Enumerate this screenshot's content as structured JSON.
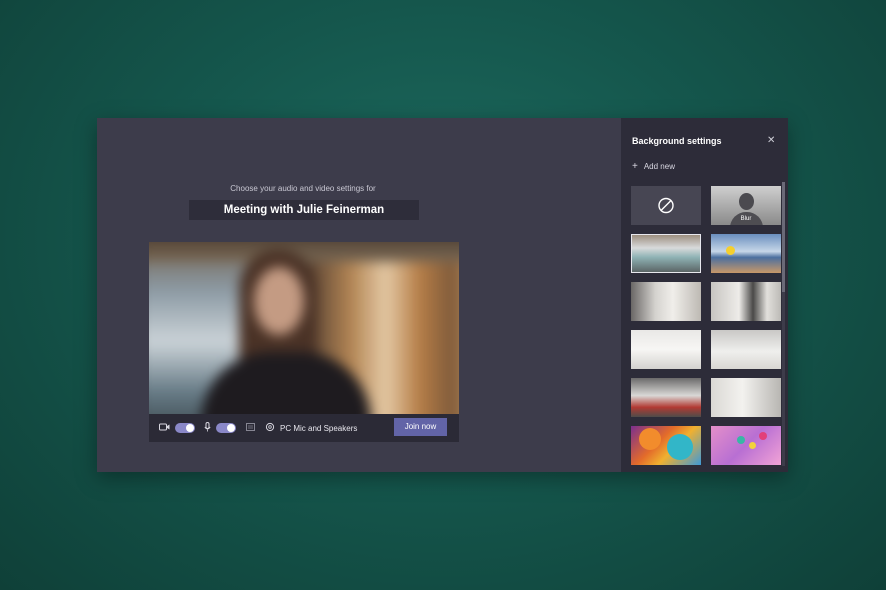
{
  "preview": {
    "subtitle": "Choose your audio and video settings for",
    "meeting_title": "Meeting with Julie Feinerman"
  },
  "controls": {
    "camera_icon": "camera-icon",
    "camera_on": true,
    "mic_icon": "microphone-icon",
    "mic_on": true,
    "audio_device": "PC Mic and Speakers",
    "join_label": "Join now"
  },
  "background_settings": {
    "title": "Background settings",
    "close_icon": "close-icon",
    "add_new_label": "Add new",
    "options": [
      {
        "kind": "none",
        "label": ""
      },
      {
        "kind": "blur",
        "label": "Blur"
      },
      {
        "kind": "image",
        "label": ""
      },
      {
        "kind": "image",
        "label": ""
      },
      {
        "kind": "image",
        "label": ""
      },
      {
        "kind": "image",
        "label": ""
      },
      {
        "kind": "image",
        "label": ""
      },
      {
        "kind": "image",
        "label": ""
      },
      {
        "kind": "image",
        "label": ""
      },
      {
        "kind": "image",
        "label": ""
      },
      {
        "kind": "image",
        "label": ""
      },
      {
        "kind": "image",
        "label": ""
      }
    ]
  },
  "colors": {
    "accent": "#6264a7",
    "panel_bg": "#2d2c39",
    "main_bg": "#3d3c4b",
    "desktop_bg": "#15574d"
  }
}
